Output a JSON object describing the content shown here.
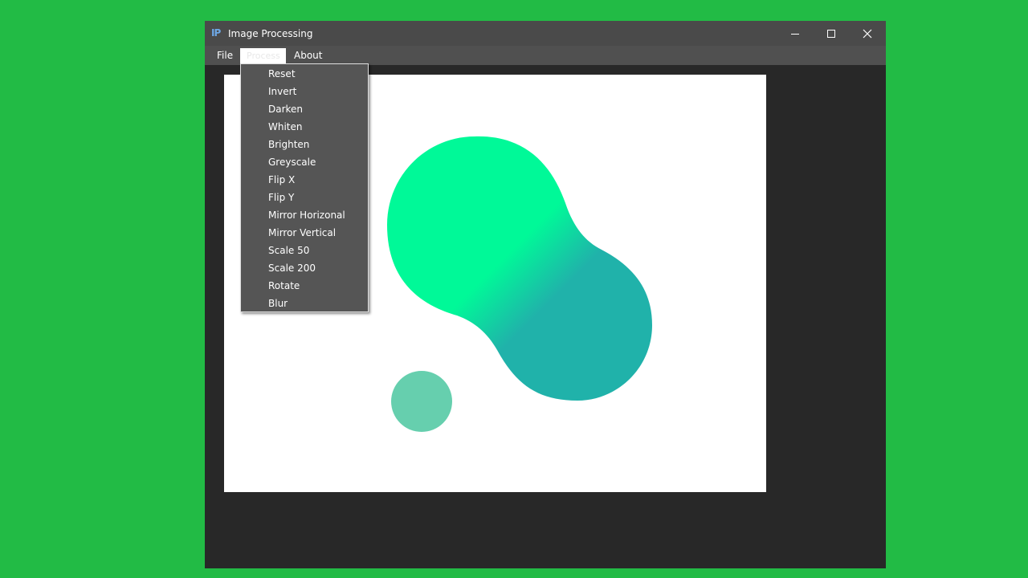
{
  "window": {
    "title": "Image Processing",
    "icon": "IP",
    "controls": {
      "minimize": "minimize-icon",
      "maximize": "maximize-icon",
      "close": "close-icon"
    }
  },
  "menubar": {
    "file": "File",
    "process": "Process",
    "about": "About"
  },
  "process_menu": {
    "items": [
      "Reset",
      "Invert",
      "Darken",
      "Whiten",
      "Brighten",
      "Greyscale",
      "Flip X",
      "Flip Y",
      "Mirror Horizonal",
      "Mirror Vertical",
      "Scale 50",
      "Scale 200",
      "Rotate",
      "Blur"
    ]
  },
  "colors": {
    "background": "#22bb45",
    "titlebar": "#4a4a4a",
    "menubar": "#505050",
    "workspace": "#282828",
    "dropdown": "#555555",
    "blob_light": "#00f998",
    "blob_dark": "#20b2aa",
    "circle": "#66cfae"
  }
}
